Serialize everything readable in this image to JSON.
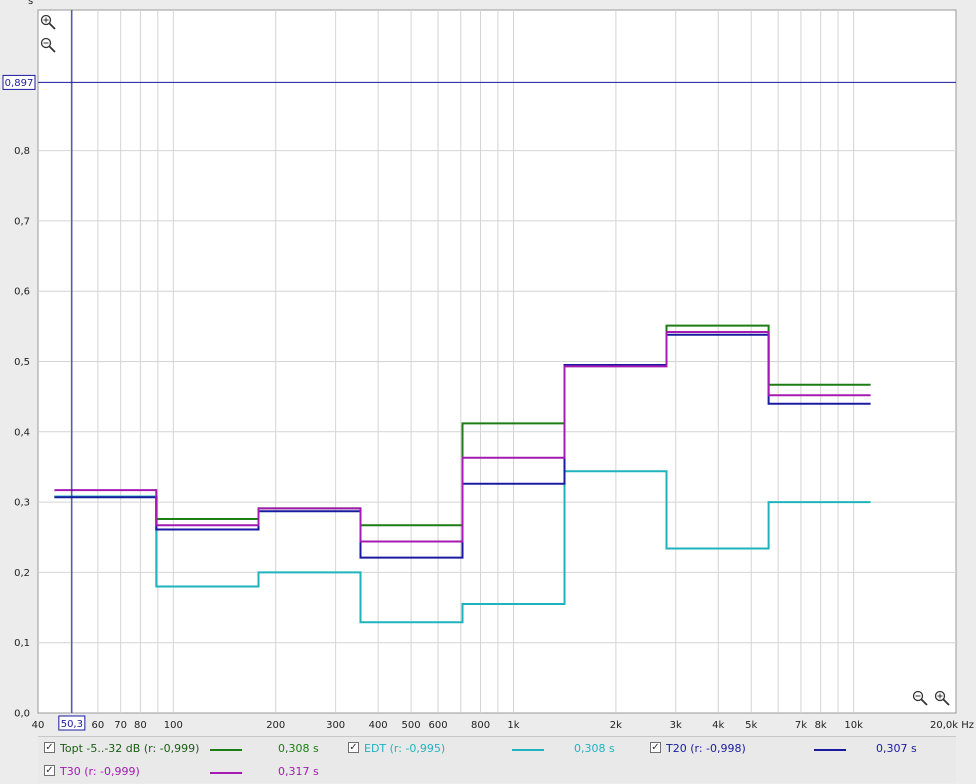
{
  "chart_data": {
    "type": "line",
    "step": true,
    "x_scale": "log",
    "xlim": [
      40,
      20000
    ],
    "ylim": [
      0,
      1.0
    ],
    "y_ticks": [
      "0,0",
      "0,1",
      "0,2",
      "0,3",
      "0,4",
      "0,5",
      "0,6",
      "0,7",
      "0,8"
    ],
    "x_ticks": [
      {
        "v": 40,
        "label": "40"
      },
      {
        "v": 60,
        "label": "60"
      },
      {
        "v": 70,
        "label": "70"
      },
      {
        "v": 80,
        "label": "80"
      },
      {
        "v": 100,
        "label": "100"
      },
      {
        "v": 200,
        "label": "200"
      },
      {
        "v": 300,
        "label": "300"
      },
      {
        "v": 400,
        "label": "400"
      },
      {
        "v": 500,
        "label": "500"
      },
      {
        "v": 600,
        "label": "600"
      },
      {
        "v": 800,
        "label": "800"
      },
      {
        "v": 1000,
        "label": "1k"
      },
      {
        "v": 2000,
        "label": "2k"
      },
      {
        "v": 3000,
        "label": "3k"
      },
      {
        "v": 4000,
        "label": "4k"
      },
      {
        "v": 5000,
        "label": "5k"
      },
      {
        "v": 7000,
        "label": "7k"
      },
      {
        "v": 8000,
        "label": "8k"
      },
      {
        "v": 10000,
        "label": "10k"
      }
    ],
    "x_end_label": "20,0k Hz",
    "band_edges": [
      44.7,
      89.1,
      178,
      355,
      708,
      1413,
      2818,
      5623,
      11220
    ],
    "series": [
      {
        "name": "Topt -5..-32 dB (r: -0,999)",
        "color": "#1b7d14",
        "values": [
          0.308,
          0.276,
          0.291,
          0.267,
          0.412,
          0.495,
          0.551,
          0.467
        ]
      },
      {
        "name": "EDT (r: -0,995)",
        "color": "#1fb3be",
        "values": [
          0.308,
          0.18,
          0.2,
          0.129,
          0.155,
          0.344,
          0.234,
          0.3
        ]
      },
      {
        "name": "T20 (r: -0,998)",
        "color": "#1a1aa0",
        "values": [
          0.307,
          0.261,
          0.287,
          0.221,
          0.326,
          0.495,
          0.538,
          0.44
        ]
      },
      {
        "name": "T30 (r: -0,999)",
        "color": "#a51ab2",
        "values": [
          0.317,
          0.267,
          0.291,
          0.244,
          0.363,
          0.493,
          0.542,
          0.452
        ]
      }
    ],
    "cursor": {
      "x_label": "50,3",
      "y_label": "0,897",
      "x": 50.3,
      "y": 0.897
    },
    "grid": true
  },
  "top_label": "s",
  "legend": [
    {
      "label": "Topt -5..-32 dB (r: -0,999)",
      "value": "0,308 s",
      "color": "#1b7d14",
      "checked": true
    },
    {
      "label": "EDT (r: -0,995)",
      "value": "0,308 s",
      "color": "#1fb3be",
      "checked": true
    },
    {
      "label": "T20 (r: -0,998)",
      "value": "0,307 s",
      "color": "#1a1aa0",
      "checked": true
    },
    {
      "label": "T30 (r: -0,999)",
      "value": "0,317 s",
      "color": "#a51ab2",
      "checked": true
    }
  ],
  "icons": {
    "zoom_in": "zoom-in-icon",
    "zoom_out": "zoom-out-icon"
  }
}
